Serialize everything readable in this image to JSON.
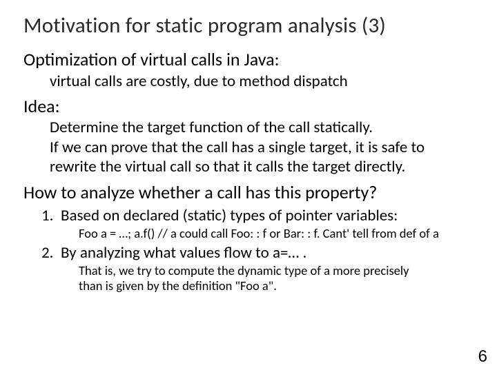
{
  "title": "Motivation for static program analysis (3)",
  "h2a": "Optimization of  virtual calls in Java:",
  "sub1": "virtual calls are costly, due to method dispatch",
  "h2b": "Idea:",
  "idea1": "Determine the target function of the call statically.",
  "idea2": "If we can prove that the call has a single target, it is safe to",
  "idea3": "rewrite the virtual call so that it calls the target directly.",
  "h2c": "How to analyze whether a call has this property?",
  "item1_num": "1.",
  "item1_text": "Based on declared (static) types of pointer variables:",
  "item1_note": "Foo a = …; a.f()  // a could call Foo: : f or Bar: : f.  Cant' tell from def of a",
  "item2_num": "2.",
  "item2_text": "By analyzing what values flow to a=… .",
  "item2_note1": "That is, we try to compute the dynamic type of a more precisely",
  "item2_note2": "than is given by the definition \"Foo a\".",
  "pagenum": "6"
}
